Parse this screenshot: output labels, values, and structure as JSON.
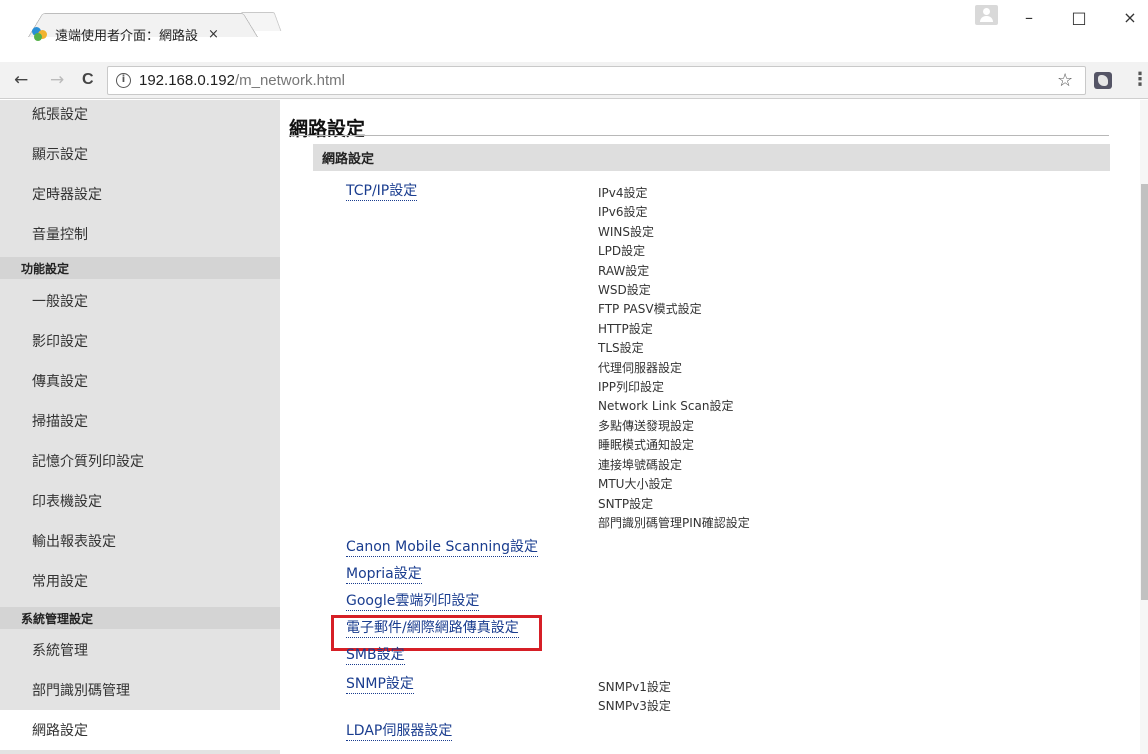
{
  "browser": {
    "tab_title": "遠端使用者介面：網路設",
    "tab_close": "×",
    "url_host": "192.168.0.192",
    "url_path": "/m_network.html",
    "back": "←",
    "forward": "→",
    "reload": "C",
    "star": "☆",
    "menu": "⋮",
    "win_minimize": "–",
    "win_maximize": "□",
    "win_close": "×"
  },
  "sidebar": {
    "items_top": [
      {
        "label": "紙張設定"
      },
      {
        "label": "顯示設定"
      },
      {
        "label": "定時器設定"
      },
      {
        "label": "音量控制"
      }
    ],
    "heading_func": "功能設定",
    "items_func": [
      {
        "label": "一般設定"
      },
      {
        "label": "影印設定"
      },
      {
        "label": "傳真設定"
      },
      {
        "label": "掃描設定"
      },
      {
        "label": "記憶介質列印設定"
      },
      {
        "label": "印表機設定"
      },
      {
        "label": "輸出報表設定"
      },
      {
        "label": "常用設定"
      }
    ],
    "heading_sys": "系統管理設定",
    "items_sys": [
      {
        "label": "系統管理"
      },
      {
        "label": "部門識別碼管理"
      },
      {
        "label": "網路設定"
      }
    ]
  },
  "main": {
    "title": "網路設定",
    "section": "網路設定",
    "links": [
      {
        "label": "TCP/IP設定"
      },
      {
        "label": "Canon Mobile Scanning設定"
      },
      {
        "label": "Mopria設定"
      },
      {
        "label": "Google雲端列印設定"
      },
      {
        "label": "電子郵件/網際網路傳真設定"
      },
      {
        "label": "SMB設定"
      },
      {
        "label": "SNMP設定"
      },
      {
        "label": "LDAP伺服器設定"
      }
    ],
    "tcpip_sub": [
      "IPv4設定",
      "IPv6設定",
      "WINS設定",
      "LPD設定",
      "RAW設定",
      "WSD設定",
      "FTP PASV模式設定",
      "HTTP設定",
      "TLS設定",
      "代理伺服器設定",
      "IPP列印設定",
      "Network Link Scan設定",
      "多點傳送發現設定",
      "睡眠模式通知設定",
      "連接埠號碼設定",
      "MTU大小設定",
      "SNTP設定",
      "部門識別碼管理PIN確認設定"
    ],
    "snmp_sub": [
      "SNMPv1設定",
      "SNMPv3設定"
    ]
  },
  "colors": {
    "link": "#1a3d8f",
    "highlight": "#d61f26",
    "sidebar_bg": "#e3e3e3"
  }
}
